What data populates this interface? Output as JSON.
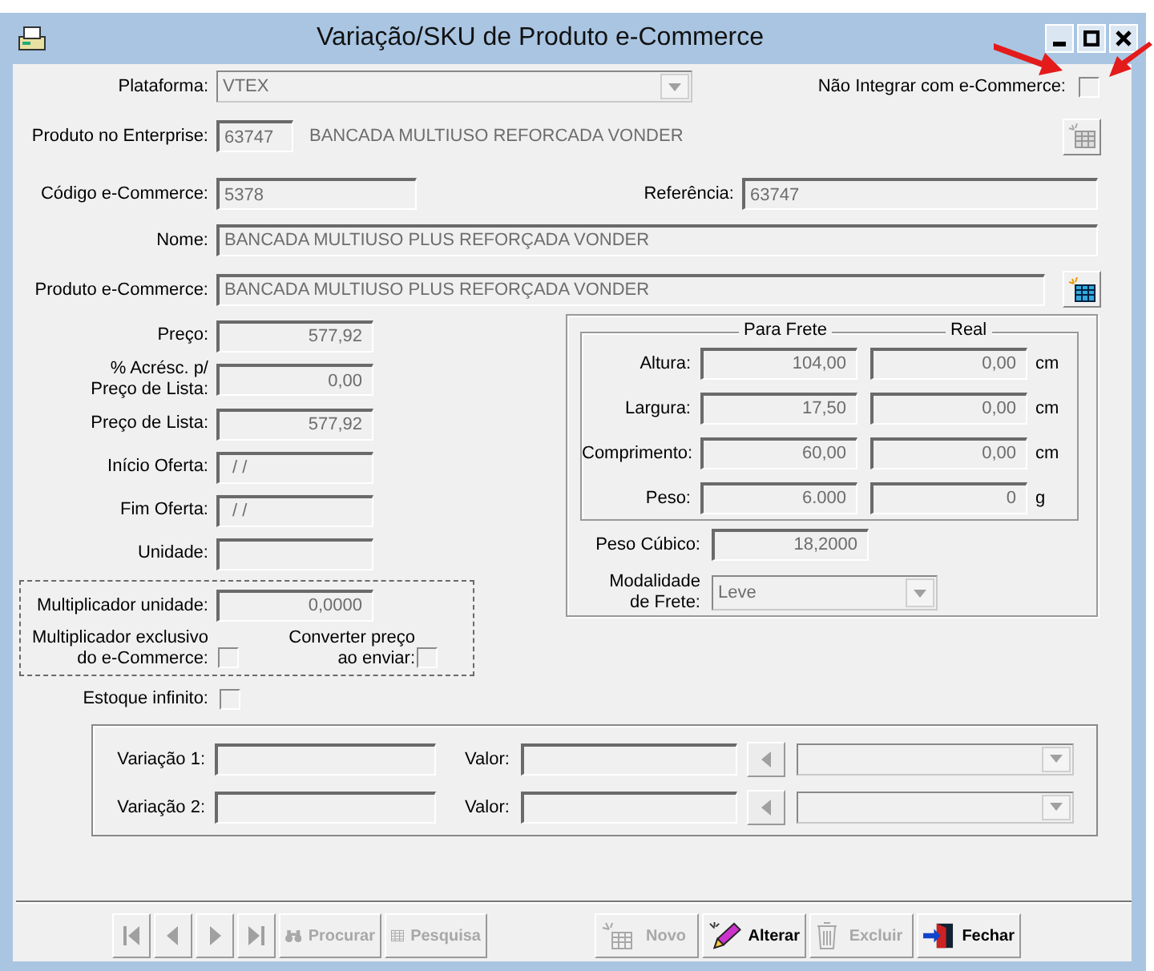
{
  "window": {
    "title": "Variação/SKU de Produto e-Commerce"
  },
  "plataforma": {
    "label": "Plataforma:",
    "value": "VTEX"
  },
  "nao_integrar": {
    "label": "Não Integrar com e-Commerce:",
    "checked": false
  },
  "produto_enterprise": {
    "label": "Produto no Enterprise:",
    "code": "63747",
    "description": "BANCADA MULTIUSO REFORCADA VONDER"
  },
  "codigo": {
    "label": "Código e-Commerce:",
    "value": "5378"
  },
  "referencia": {
    "label": "Referência:",
    "value": "63747"
  },
  "nome": {
    "label": "Nome:",
    "value": "BANCADA MULTIUSO PLUS REFORÇADA VONDER"
  },
  "produto_ecommerce": {
    "label": "Produto e-Commerce:",
    "value": "BANCADA MULTIUSO PLUS REFORÇADA VONDER"
  },
  "pricing": [
    {
      "label": "Preço:",
      "value": "577,92",
      "kind": "number"
    },
    {
      "label": "% Acrésc. p/\nPreço de Lista:",
      "value": "0,00",
      "kind": "number"
    },
    {
      "label": "Preço de Lista:",
      "value": "577,92",
      "kind": "number"
    },
    {
      "label": "Início Oferta:",
      "value": " / /",
      "kind": "date"
    },
    {
      "label": "Fim Oferta:",
      "value": " / /",
      "kind": "date"
    },
    {
      "label": "Unidade:"
    }
  ],
  "multiplicador": {
    "label": "Multiplicador unidade:",
    "value": "0,0000"
  },
  "exclusivo": {
    "label": "Multiplicador exclusivo\ndo e-Commerce:",
    "checked": false
  },
  "converter": {
    "label": "Converter preço\nao enviar:",
    "checked": false
  },
  "estoque_infinito": {
    "label": "Estoque infinito:",
    "checked": false
  },
  "dimensions": {
    "columns": [
      "Para Frete",
      "Real"
    ],
    "rows": [
      {
        "label": "Altura:",
        "frete": "104,00",
        "real": "0,00",
        "unit": "cm"
      },
      {
        "label": "Largura:",
        "frete": "17,50",
        "real": "0,00",
        "unit": "cm"
      },
      {
        "label": "Comprimento:",
        "frete": "60,00",
        "real": "0,00",
        "unit": "cm"
      },
      {
        "label": "Peso:",
        "frete": "6.000",
        "real": "0",
        "unit": "g"
      }
    ]
  },
  "peso_cubico": {
    "label": "Peso Cúbico:",
    "value": "18,2000"
  },
  "modalidade": {
    "label": "Modalidade\nde Frete:",
    "value": "Leve"
  },
  "variations": [
    {
      "label": "Variação 1:",
      "value_label": "Valor:"
    },
    {
      "label": "Variação 2:",
      "value_label": "Valor:"
    }
  ],
  "nav_buttons": [
    {
      "kind": "first",
      "disabled": true
    },
    {
      "kind": "prev",
      "disabled": true
    },
    {
      "kind": "next",
      "disabled": true
    },
    {
      "kind": "last",
      "disabled": true
    },
    {
      "kind": "search",
      "label": "Procurar",
      "disabled": true
    },
    {
      "kind": "grid",
      "label": "Pesquisa",
      "disabled": true
    }
  ],
  "action_buttons": [
    {
      "kind": "new",
      "label": "Novo",
      "disabled": true
    },
    {
      "kind": "edit",
      "label": "Alterar",
      "disabled": false
    },
    {
      "kind": "delete",
      "label": "Excluir",
      "disabled": true
    },
    {
      "kind": "close",
      "label": "Fechar",
      "disabled": false
    }
  ]
}
